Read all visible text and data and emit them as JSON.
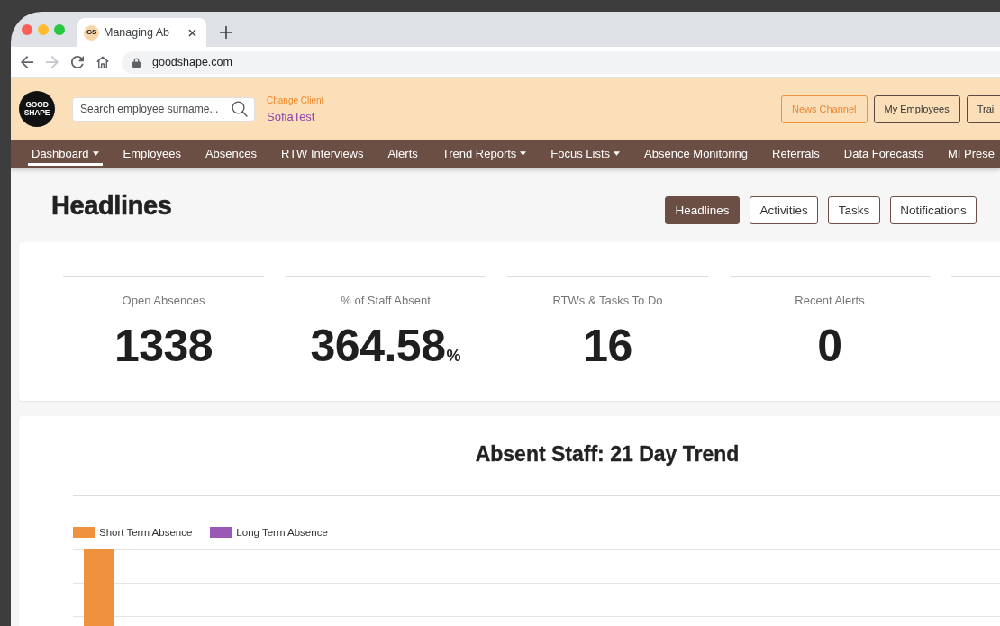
{
  "browser": {
    "tab": {
      "favicon": "GS",
      "title": "Managing Ab"
    },
    "controls": [
      {
        "kind": "back",
        "disabled": false
      },
      {
        "kind": "forward",
        "disabled": true
      },
      {
        "kind": "reload",
        "disabled": false
      },
      {
        "kind": "home",
        "disabled": false
      }
    ],
    "address": "goodshape.com"
  },
  "header": {
    "logo": "GOOD SHAPE",
    "search": {
      "placeholder": "Search employee surname..."
    },
    "client": {
      "link": "Change Client",
      "name": "SofiaTest"
    },
    "buttons": [
      {
        "label": "News Channel",
        "kind": "highlight"
      },
      {
        "label": "My Employees",
        "kind": "plain"
      },
      {
        "label": "Trai",
        "kind": "plain"
      }
    ]
  },
  "nav": [
    {
      "label": "Dashboard",
      "dropdown": true,
      "selected": true
    },
    {
      "label": "Employees",
      "dropdown": false,
      "selected": false
    },
    {
      "label": "Absences",
      "dropdown": false,
      "selected": false
    },
    {
      "label": "RTW Interviews",
      "dropdown": false,
      "selected": false
    },
    {
      "label": "Alerts",
      "dropdown": false,
      "selected": false
    },
    {
      "label": "Trend Reports",
      "dropdown": true,
      "selected": false
    },
    {
      "label": "Focus Lists",
      "dropdown": true,
      "selected": false
    },
    {
      "label": "Absence Monitoring",
      "dropdown": false,
      "selected": false
    },
    {
      "label": "Referrals",
      "dropdown": false,
      "selected": false
    },
    {
      "label": "Data Forecasts",
      "dropdown": false,
      "selected": false
    },
    {
      "label": "MI Prese",
      "dropdown": false,
      "selected": false
    }
  ],
  "page": {
    "title": "Headlines",
    "views": [
      {
        "label": "Headlines",
        "selected": true
      },
      {
        "label": "Activities",
        "selected": false
      },
      {
        "label": "Tasks",
        "selected": false
      },
      {
        "label": "Notifications",
        "selected": false
      }
    ]
  },
  "stats": [
    {
      "label": "Open Absences",
      "value": "1338"
    },
    {
      "label": "% of Staff Absent",
      "value": "364.58",
      "unit": "%"
    },
    {
      "label": "RTWs & Tasks To Do",
      "value": "16"
    },
    {
      "label": "Recent Alerts",
      "value": "0"
    }
  ],
  "chart": {
    "title": "Absent Staff: 21 Day Trend",
    "legend": [
      {
        "label": "Short Term Absence",
        "color": "#f0913d"
      },
      {
        "label": "Long Term Absence",
        "color": "#9b59b6"
      }
    ]
  }
}
